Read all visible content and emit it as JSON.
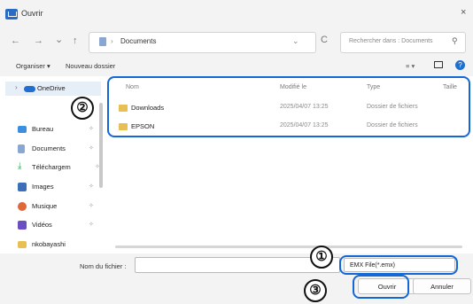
{
  "window": {
    "title": "Ouvrir",
    "close_glyph": "×"
  },
  "nav": {
    "back_glyph": "←",
    "forward_glyph": "→",
    "recent_glyph": "⌄",
    "up_glyph": "↑",
    "path_separator": "›",
    "path_current": "Documents",
    "dropdown_glyph": "⌄",
    "refresh_glyph": "C",
    "search_placeholder": "Rechercher dans : Documents",
    "search_glyph": "⚲"
  },
  "toolbar": {
    "organize": "Organiser ▾",
    "new_folder": "Nouveau dossier",
    "view_glyph": "≡ ▾"
  },
  "sidebar": {
    "items": [
      {
        "label": "OneDrive",
        "icon": "cloud-icon",
        "color": "#1f6fd1",
        "expander": "›",
        "pin": ""
      },
      {
        "label": "Bureau",
        "icon": "desktop-icon",
        "color": "#3b8ee0",
        "pin": "✧"
      },
      {
        "label": "Documents",
        "icon": "document-icon",
        "color": "#8aa6d3",
        "pin": "✧"
      },
      {
        "label": "Téléchargem",
        "icon": "download-icon",
        "color": "#2f9e58",
        "pin": "✧"
      },
      {
        "label": "Images",
        "icon": "images-icon",
        "color": "#3d6fb8",
        "pin": "✧"
      },
      {
        "label": "Musique",
        "icon": "music-icon",
        "color": "#e0673a",
        "pin": "✧"
      },
      {
        "label": "Vidéos",
        "icon": "video-icon",
        "color": "#6a4fc2",
        "pin": "✧"
      },
      {
        "label": "nkobayashi",
        "icon": "folder-icon",
        "color": "#e8bf52",
        "pin": ""
      }
    ]
  },
  "file_list": {
    "columns": [
      "Nom",
      "Modifié le",
      "Type",
      "Taille"
    ],
    "rows": [
      {
        "name": "Downloads",
        "modified": "2025/04/07 13:25",
        "type": "Dossier de fichiers"
      },
      {
        "name": "EPSON",
        "modified": "2025/04/07 13:25",
        "type": "Dossier de fichiers"
      }
    ]
  },
  "bottom": {
    "filename_label": "Nom du fichier :",
    "filename_value": "",
    "file_type": "EMX File(*.emx)",
    "open_button": "Ouvrir",
    "cancel_button": "Annuler"
  },
  "callouts": [
    "①",
    "②",
    "③"
  ],
  "colors": {
    "highlight": "#1467d7",
    "accent": "#2a6cc4"
  }
}
